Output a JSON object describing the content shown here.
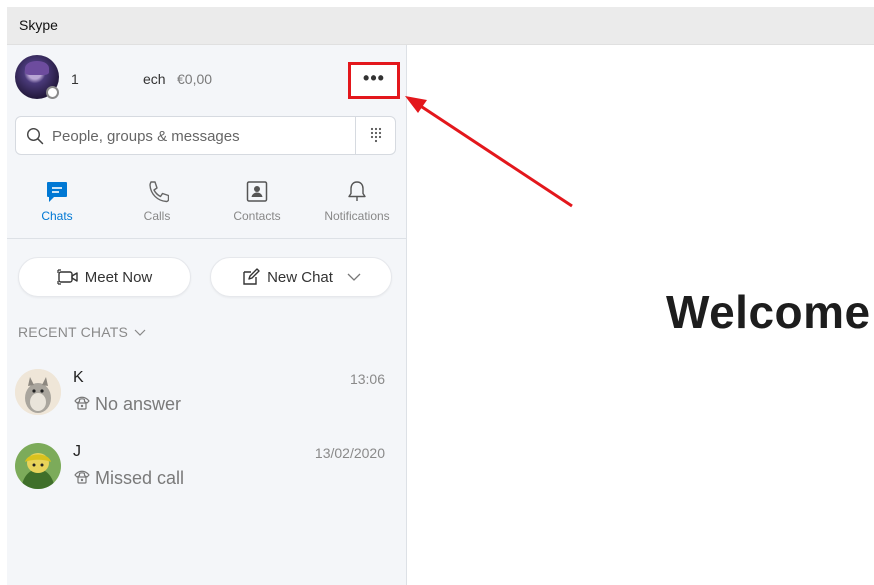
{
  "window": {
    "title": "Skype"
  },
  "profile": {
    "name_part1": "1",
    "name_part2": "ech",
    "credit": "€0,00",
    "more_label": "•••"
  },
  "search": {
    "placeholder": "People, groups & messages"
  },
  "nav": [
    {
      "label": "Chats",
      "icon": "chat-icon",
      "active": true
    },
    {
      "label": "Calls",
      "icon": "phone-icon"
    },
    {
      "label": "Contacts",
      "icon": "contacts-icon"
    },
    {
      "label": "Notifications",
      "icon": "bell-icon"
    }
  ],
  "actions": {
    "meet_now": "Meet Now",
    "new_chat": "New Chat"
  },
  "recent": {
    "header": "RECENT CHATS",
    "chats": [
      {
        "name": "K",
        "time": "13:06",
        "status": "No answer"
      },
      {
        "name": "J",
        "time": "13/02/2020",
        "status": "Missed call"
      }
    ]
  },
  "main": {
    "welcome": "Welcome"
  },
  "colors": {
    "accent": "#0078d4",
    "highlight": "#e3171c",
    "sidebar_bg": "#f4f6f9"
  }
}
